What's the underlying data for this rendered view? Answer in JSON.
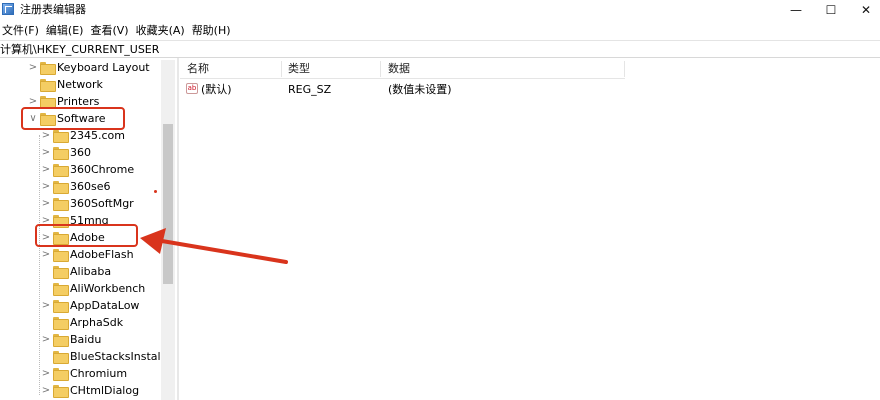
{
  "window": {
    "title": "注册表编辑器",
    "controls": {
      "minimize": "—",
      "maximize": "☐",
      "close": "✕"
    }
  },
  "menu": [
    "文件(F)",
    "编辑(E)",
    "查看(V)",
    "收藏夹(A)",
    "帮助(H)"
  ],
  "address": "计算机\\HKEY_CURRENT_USER",
  "tree": {
    "top_items": [
      {
        "label": "Keyboard Layout",
        "expand": ">"
      },
      {
        "label": "Network",
        "expand": ""
      },
      {
        "label": "Printers",
        "expand": ">"
      },
      {
        "label": "Software",
        "expand": "∨"
      }
    ],
    "software_children": [
      {
        "label": "2345.com",
        "expand": ">"
      },
      {
        "label": "360",
        "expand": ">"
      },
      {
        "label": "360Chrome",
        "expand": ">"
      },
      {
        "label": "360se6",
        "expand": ">"
      },
      {
        "label": "360SoftMgr",
        "expand": ">"
      },
      {
        "label": "51mnq",
        "expand": ">"
      },
      {
        "label": "Adobe",
        "expand": ">"
      },
      {
        "label": "AdobeFlash",
        "expand": ">"
      },
      {
        "label": "Alibaba",
        "expand": ""
      },
      {
        "label": "AliWorkbench",
        "expand": ""
      },
      {
        "label": "AppDataLow",
        "expand": ">"
      },
      {
        "label": "ArphaSdk",
        "expand": ""
      },
      {
        "label": "Baidu",
        "expand": ">"
      },
      {
        "label": "BlueStacksInstaller",
        "expand": ""
      },
      {
        "label": "Chromium",
        "expand": ">"
      },
      {
        "label": "CHtmlDialog",
        "expand": ">"
      }
    ]
  },
  "list": {
    "columns": [
      "名称",
      "类型",
      "数据"
    ],
    "rows": [
      {
        "icon": "ab",
        "name": "(默认)",
        "type": "REG_SZ",
        "data": "(数值未设置)"
      }
    ]
  },
  "colors": {
    "annotation": "#d9341c",
    "folder": "#f4cd63"
  }
}
